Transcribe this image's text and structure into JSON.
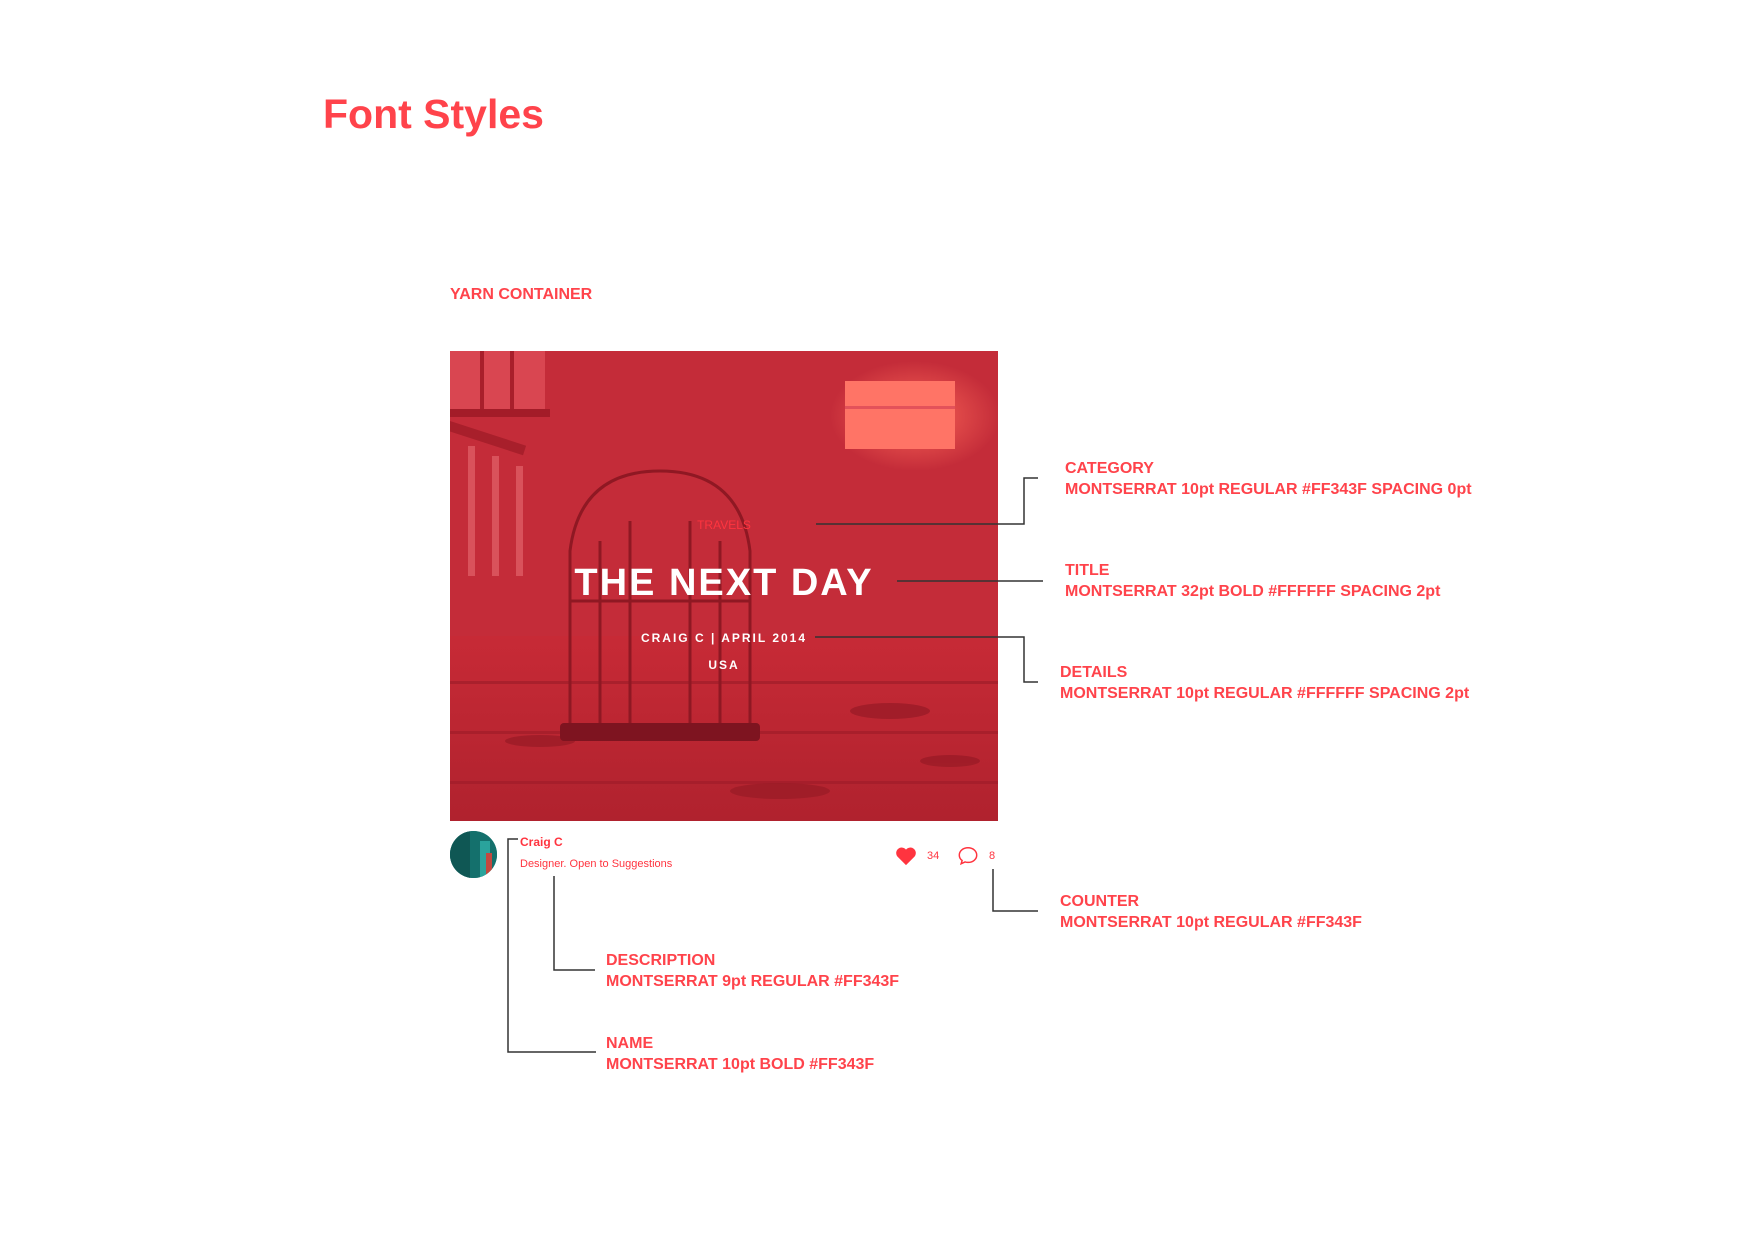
{
  "page": {
    "title": "Font Styles",
    "section_label": "YARN CONTAINER"
  },
  "card": {
    "category": "TRAVELS",
    "title": "THE NEXT DAY",
    "details": "CRAIG C | APRIL 2014",
    "location": "USA",
    "overlay_color": "#FF343F"
  },
  "author": {
    "name": "Craig C",
    "description": "Designer. Open to Suggestions",
    "likes": "34",
    "comments": "8",
    "icons": [
      "heart-icon",
      "comment-icon"
    ]
  },
  "annotations": {
    "category": {
      "heading": "CATEGORY",
      "spec": "MONTSERRAT 10pt REGULAR #FF343F SPACING 0pt"
    },
    "title": {
      "heading": "TITLE",
      "spec": "MONTSERRAT 32pt BOLD #FFFFFF SPACING 2pt"
    },
    "details": {
      "heading": "DETAILS",
      "spec": "MONTSERRAT 10pt REGULAR #FFFFFF SPACING 2pt"
    },
    "counter": {
      "heading": "COUNTER",
      "spec": "MONTSERRAT 10pt REGULAR #FF343F"
    },
    "description": {
      "heading": "DESCRIPTION",
      "spec": "MONTSERRAT 9pt REGULAR #FF343F"
    },
    "name": {
      "heading": "NAME",
      "spec": "MONTSERRAT 10pt BOLD #FF343F"
    }
  },
  "colors": {
    "accent": "#FF343F",
    "white": "#FFFFFF"
  }
}
